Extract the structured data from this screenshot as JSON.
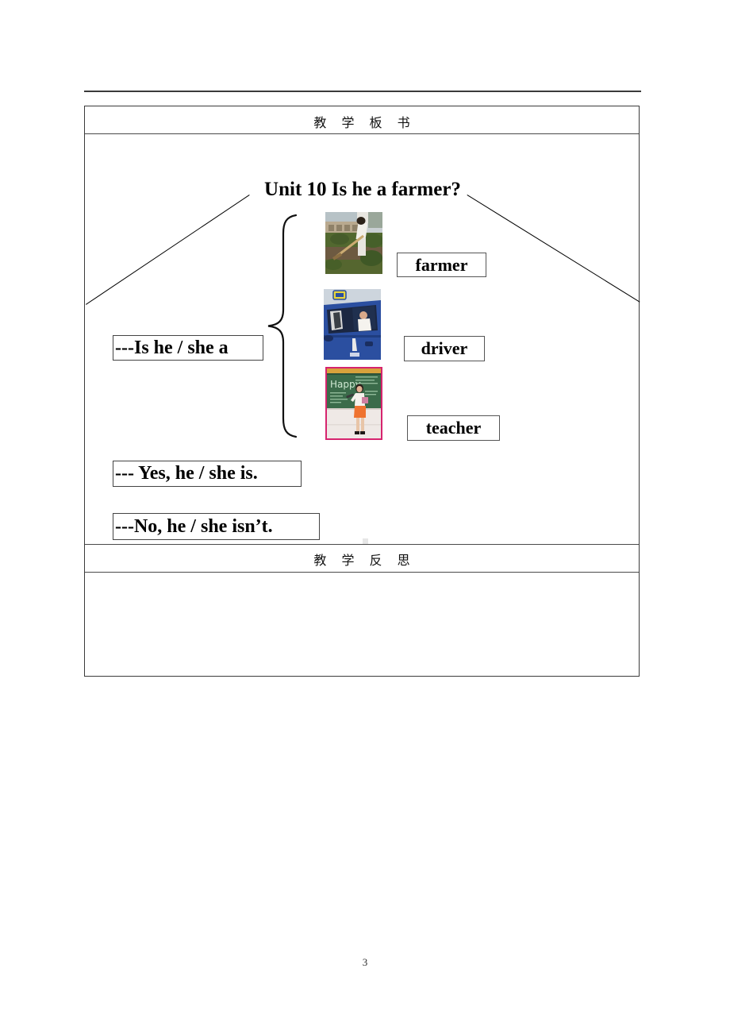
{
  "document": {
    "page_number": "3"
  },
  "table": {
    "header_row": {
      "title": "教 学 板 书"
    },
    "board": {
      "unit_title": "Unit 10 Is he a farmer?",
      "sentences": {
        "question": "---Is he / she a",
        "affirmative": "--- Yes, he / she is.",
        "negative": "---No, he / she isn’t."
      },
      "vocabulary": [
        {
          "word": "farmer",
          "image_alt": "man hoeing in a vegetable garden",
          "colors": {
            "sky": "#c9cfd2",
            "wall": "#b9a98f",
            "foliage": "#4f6b33",
            "soil": "#6d5a41",
            "shirt": "#f2f0ea"
          }
        },
        {
          "word": "driver",
          "image_alt": "driver sitting in a blue truck cab",
          "colors": {
            "truck": "#2b4fa0",
            "window": "#1b2742",
            "badge": "#e8d43c",
            "shirt": "#f5f3ee",
            "sky": "#cdd5dd"
          }
        },
        {
          "word": "teacher",
          "image_alt": "teacher at a green chalkboard with Happy written on it",
          "board_text": "Happy",
          "colors": {
            "border": "#d6246e",
            "chalkboard": "#3b6b4a",
            "chalk": "#dfeee0",
            "skirt": "#ef7330",
            "wall": "#efe6e2",
            "top_trim": "#d8a23c"
          }
        }
      ]
    },
    "reflection_row": {
      "title": "教 学 反 思",
      "content": ""
    }
  }
}
